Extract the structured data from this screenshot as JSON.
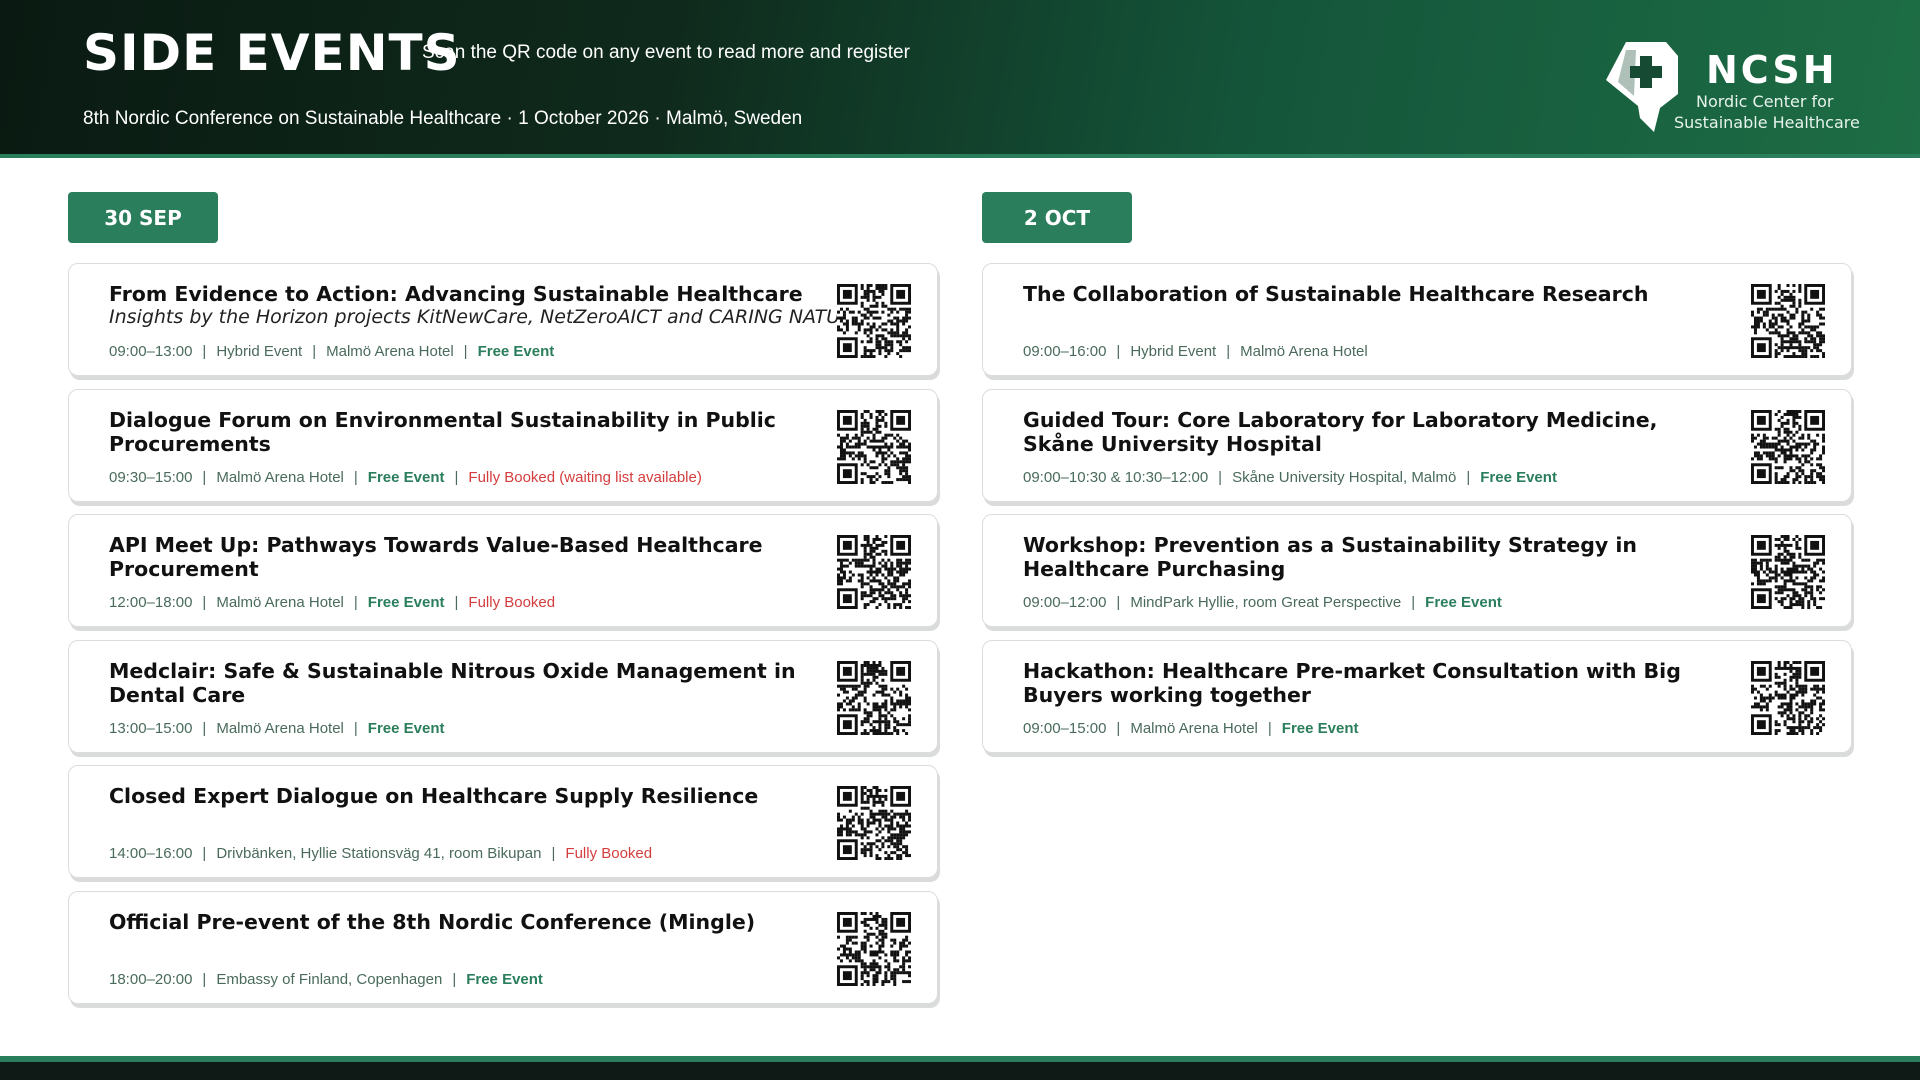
{
  "header": {
    "title": "SIDE EVENTS",
    "subtitle": "Scan the QR code on any event to read more and register",
    "conference": "8th Nordic Conference on Sustainable Healthcare · 1 October 2026 · Malmö, Sweden",
    "logo": {
      "brand": "NCSH",
      "line1": "Nordic Center for",
      "line2": "Sustainable Healthcare"
    }
  },
  "colors": {
    "accent": "#2a7e5c",
    "fully_booked": "#d43d3d",
    "meta_text": "#4a6b5b"
  },
  "left": {
    "date": "30 SEP",
    "events": [
      {
        "title": "From Evidence to Action: Advancing Sustainable Healthcare",
        "subtitle": "Insights by the Horizon projects KitNewCare, NetZeroAICT and CARING NATURE",
        "time": "09:00–13:00",
        "meta": [
          "Hybrid Event",
          "Malmö Arena Hotel"
        ],
        "free": "Free Event",
        "booked": ""
      },
      {
        "title": "Dialogue Forum on Environmental Sustainability in Public Procurements",
        "subtitle": "",
        "time": "09:30–15:00",
        "meta": [
          "Malmö Arena Hotel"
        ],
        "free": "Free Event",
        "booked": "Fully Booked (waiting list available)"
      },
      {
        "title": "API Meet Up: Pathways Towards Value-Based Healthcare Procurement",
        "subtitle": "",
        "time": "12:00–18:00",
        "meta": [
          "Malmö Arena Hotel"
        ],
        "free": "Free Event",
        "booked": "Fully Booked"
      },
      {
        "title": "Medclair: Safe & Sustainable Nitrous Oxide Management in Dental Care",
        "subtitle": "",
        "time": "13:00–15:00",
        "meta": [
          "Malmö Arena Hotel"
        ],
        "free": "Free Event",
        "booked": ""
      },
      {
        "title": "Closed Expert Dialogue on Healthcare Supply Resilience",
        "subtitle": "",
        "time": "14:00–16:00",
        "meta": [
          "Drivbänken, Hyllie Stationsväg 41, room Bikupan"
        ],
        "free": "",
        "booked": "Fully Booked"
      },
      {
        "title": "Official Pre-event of the 8th Nordic Conference (Mingle)",
        "subtitle": "",
        "time": "18:00–20:00",
        "meta": [
          "Embassy of Finland, Copenhagen"
        ],
        "free": "Free Event",
        "booked": ""
      }
    ]
  },
  "right": {
    "date": "2 OCT",
    "events": [
      {
        "title": "The Collaboration of Sustainable Healthcare Research",
        "subtitle": "",
        "time": "09:00–16:00",
        "meta": [
          "Hybrid Event",
          "Malmö Arena Hotel"
        ],
        "free": "",
        "booked": ""
      },
      {
        "title": "Guided Tour: Core Laboratory for Laboratory Medicine, Skåne University Hospital",
        "subtitle": "",
        "time": "09:00–10:30 & 10:30–12:00",
        "meta": [
          "Skåne University Hospital, Malmö"
        ],
        "free": "Free Event",
        "booked": ""
      },
      {
        "title": "Workshop: Prevention as a Sustainability Strategy in Healthcare Purchasing",
        "subtitle": "",
        "time": "09:00–12:00",
        "meta": [
          "MindPark Hyllie, room Great Perspective"
        ],
        "free": "Free Event",
        "booked": ""
      },
      {
        "title": "Hackathon: Healthcare Pre-market Consultation with Big Buyers working together",
        "subtitle": "",
        "time": "09:00–15:00",
        "meta": [
          "Malmö Arena Hotel"
        ],
        "free": "Free Event",
        "booked": ""
      }
    ]
  }
}
